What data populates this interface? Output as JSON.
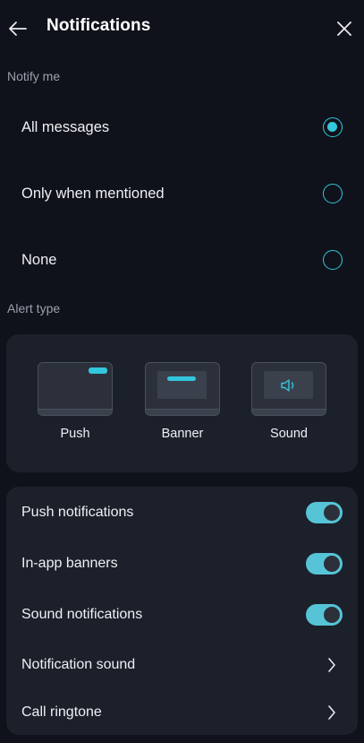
{
  "header": {
    "title": "Notifications",
    "back_icon": "arrow-left-icon",
    "close_icon": "close-icon"
  },
  "notify": {
    "section_label": "Notify me",
    "options": [
      {
        "label": "All messages",
        "selected": true
      },
      {
        "label": "Only when mentioned",
        "selected": false
      },
      {
        "label": "None",
        "selected": false
      }
    ]
  },
  "alert_type": {
    "section_label": "Alert type",
    "options": [
      {
        "label": "Push",
        "icon": "push-preview-icon"
      },
      {
        "label": "Banner",
        "icon": "banner-preview-icon"
      },
      {
        "label": "Sound",
        "icon": "speaker-icon"
      }
    ]
  },
  "settings": {
    "rows": [
      {
        "label": "Push notifications",
        "control": "toggle",
        "on": true
      },
      {
        "label": "In-app banners",
        "control": "toggle",
        "on": true
      },
      {
        "label": "Sound notifications",
        "control": "toggle",
        "on": true
      },
      {
        "label": "Notification sound",
        "control": "chevron"
      },
      {
        "label": "Call ringtone",
        "control": "chevron"
      }
    ]
  },
  "colors": {
    "accent": "#33c6dd",
    "background": "#0f121a",
    "card": "#1c202b"
  }
}
